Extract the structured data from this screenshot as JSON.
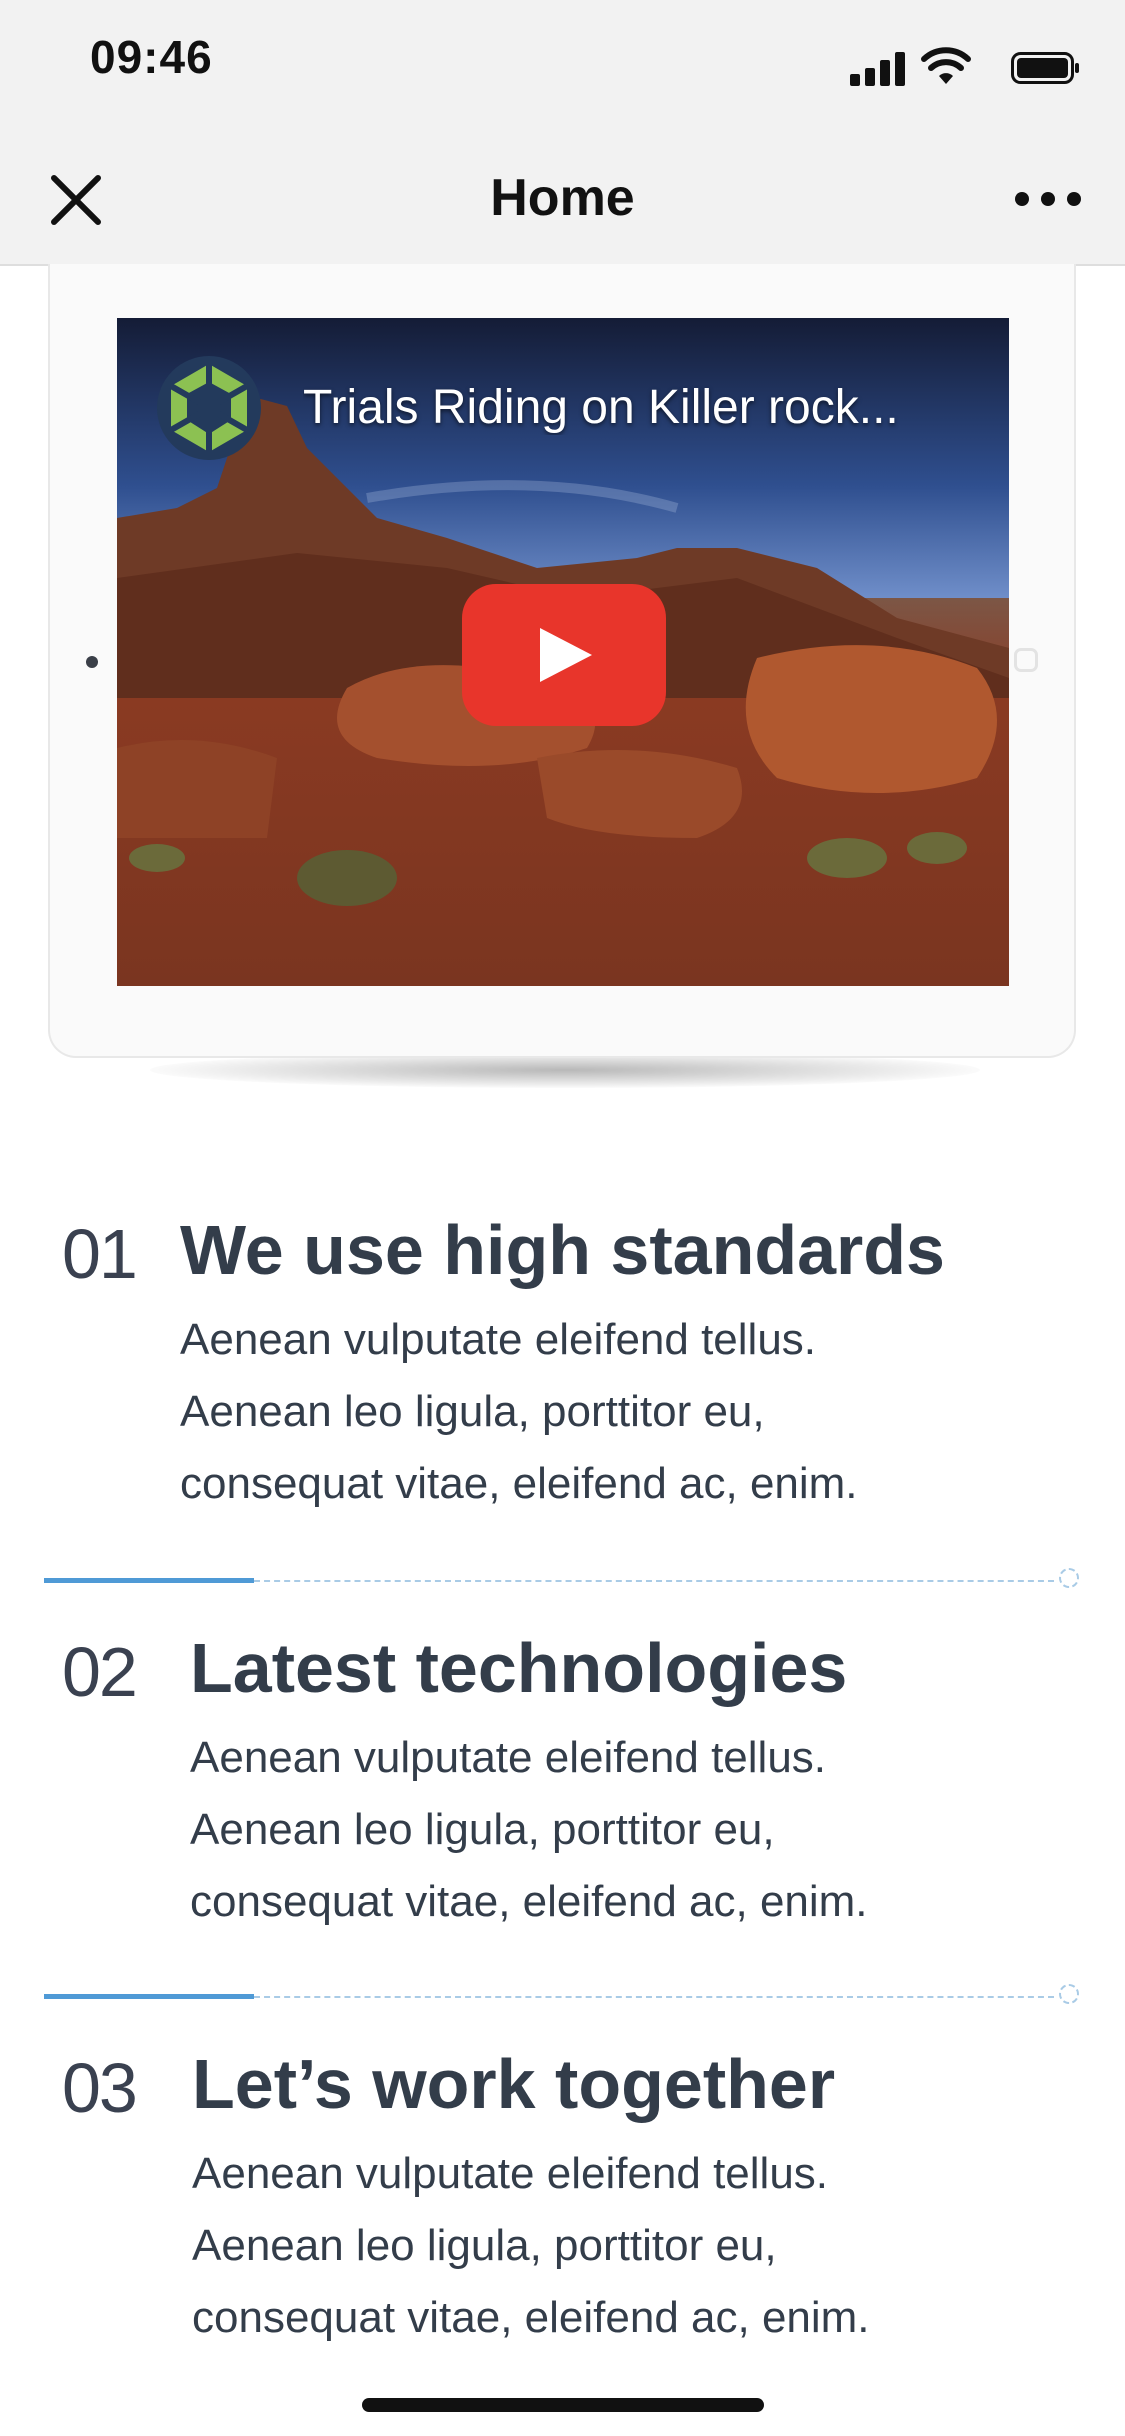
{
  "status": {
    "time": "09:46"
  },
  "nav": {
    "title": "Home"
  },
  "video": {
    "title": "Trials Riding on Killer rock...",
    "colors": {
      "play": "#e8352b",
      "logo": "#8cc152"
    }
  },
  "features": [
    {
      "number": "01",
      "title": "We use high standards",
      "desc": [
        "Aenean vulputate eleifend tellus.",
        "Aenean leo ligula, porttitor eu,",
        "consequat vitae, eleifend ac, enim."
      ]
    },
    {
      "number": "02",
      "title": "Latest technologies",
      "desc": [
        "Aenean vulputate eleifend tellus.",
        "Aenean leo ligula, porttitor eu,",
        "consequat vitae, eleifend ac, enim."
      ]
    },
    {
      "number": "03",
      "title": "Let’s work together",
      "desc": [
        "Aenean vulputate eleifend tellus.",
        "Aenean leo ligula, porttitor eu,",
        "consequat vitae, eleifend ac, enim."
      ]
    }
  ],
  "colors": {
    "accent": "#4f9ad6",
    "text": "#333d4a"
  }
}
